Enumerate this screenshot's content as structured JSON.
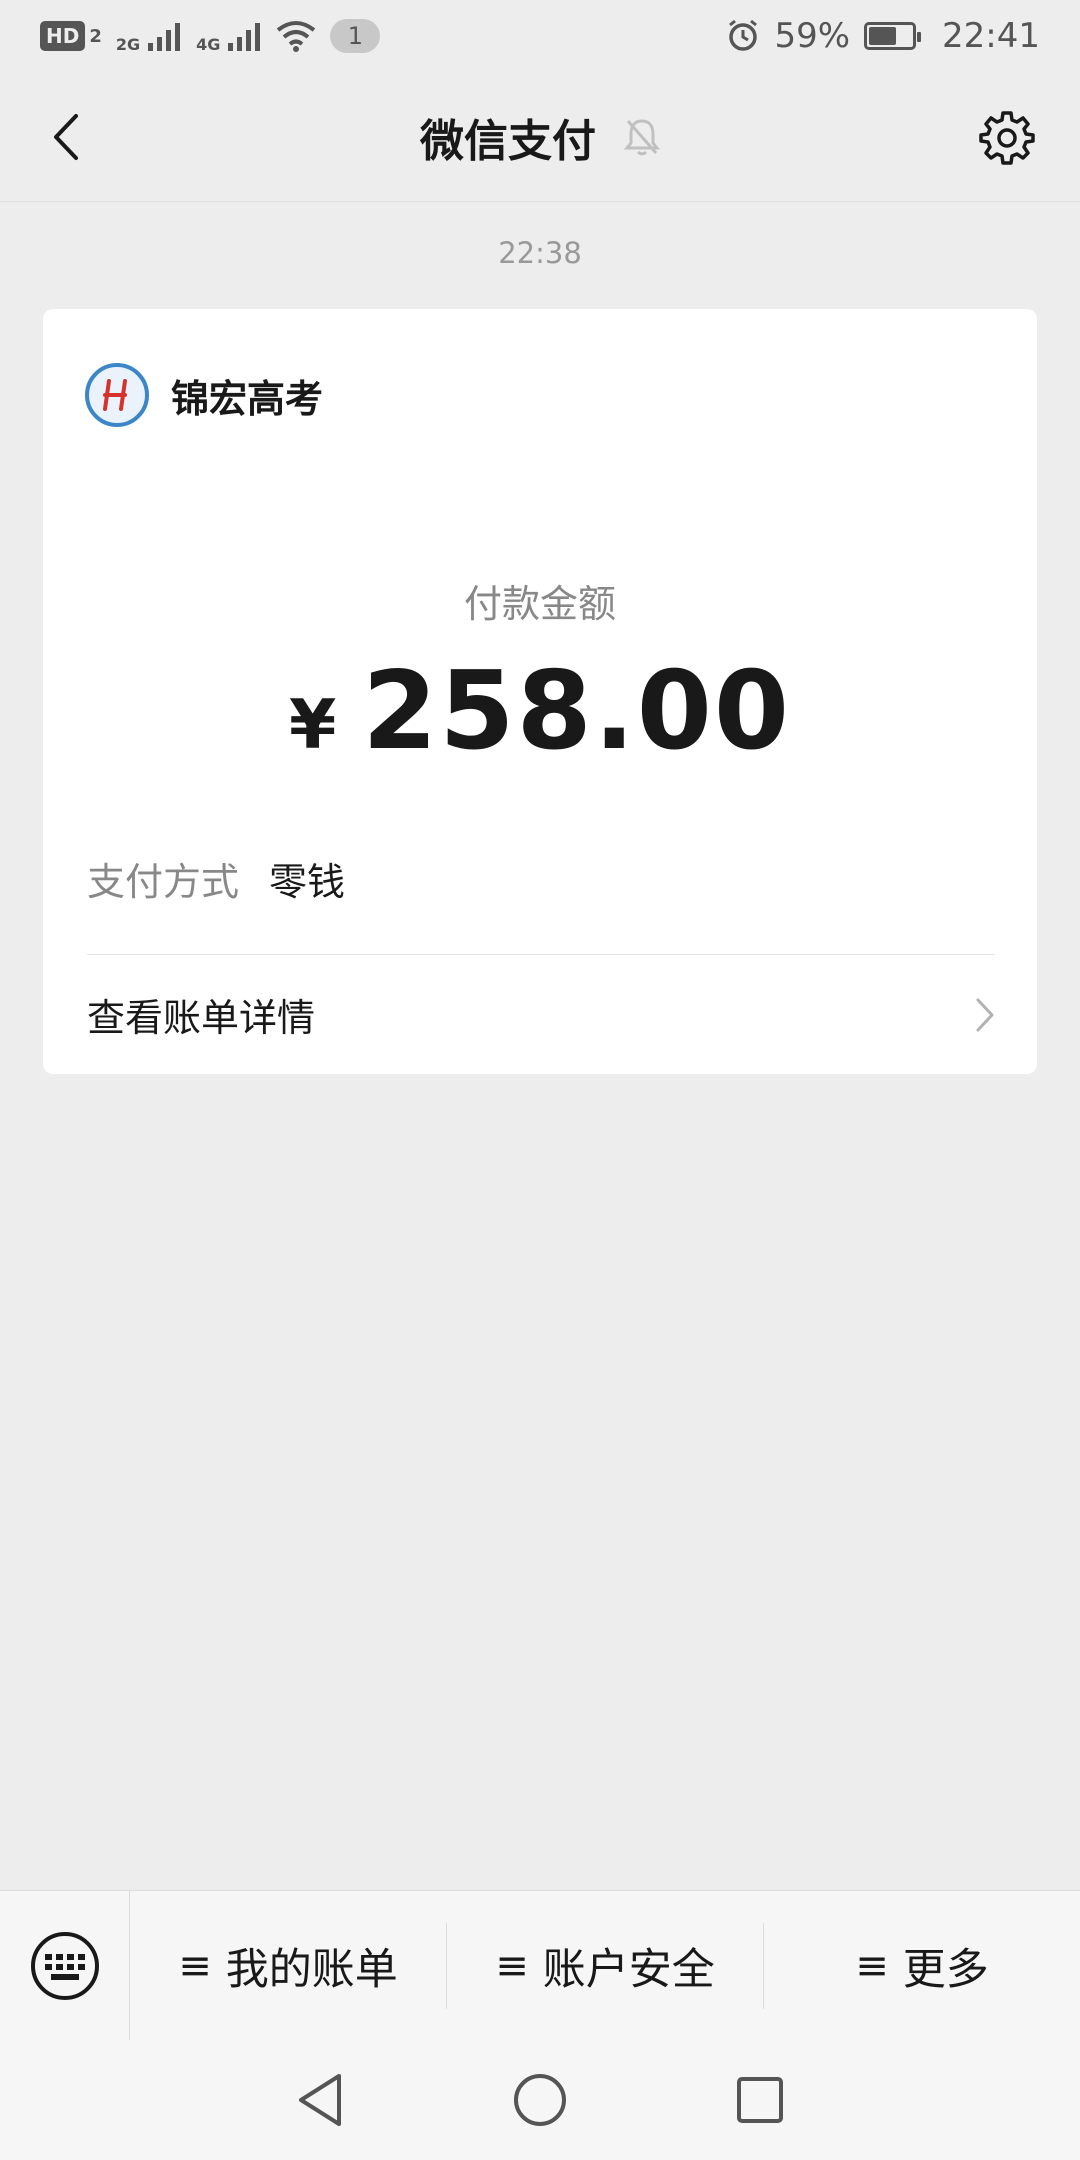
{
  "status_bar": {
    "hd_badge": "HD",
    "sim_index": "2",
    "net1": "2G",
    "net2": "4G",
    "notification_count": "1",
    "battery": "59%",
    "time": "22:41"
  },
  "header": {
    "title": "微信支付"
  },
  "message": {
    "timestamp": "22:38",
    "merchant_name": "锦宏高考",
    "amount_label": "付款金额",
    "currency": "¥",
    "amount": "258.00",
    "pay_method_label": "支付方式",
    "pay_method_value": "零钱",
    "bill_detail_label": "查看账单详情"
  },
  "bottom_menu": {
    "items": [
      {
        "glyph": "≡",
        "label": "我的账单"
      },
      {
        "glyph": "≡",
        "label": "账户安全"
      },
      {
        "glyph": "≡",
        "label": "更多"
      }
    ]
  },
  "colors": {
    "background": "#ededed",
    "card": "#ffffff",
    "text_primary": "#191919",
    "text_secondary": "#888888",
    "logo_ring": "#3a86c8"
  }
}
